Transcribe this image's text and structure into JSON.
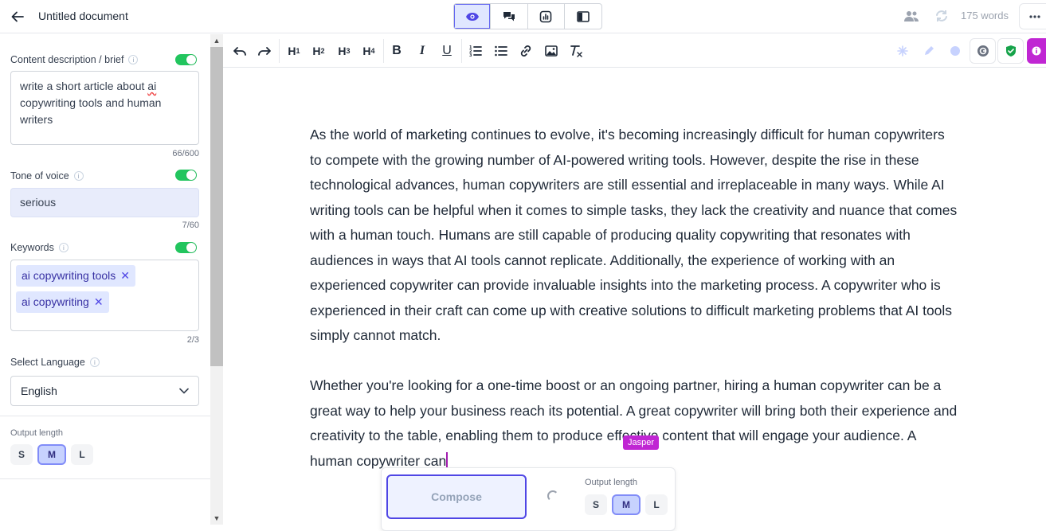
{
  "header": {
    "doc_title": "Untitled document",
    "word_count": "175 words",
    "view_modes": [
      "eye-icon",
      "chat-icon",
      "chart-icon",
      "sidebar-icon"
    ]
  },
  "left_panel": {
    "content_brief": {
      "label": "Content description / brief",
      "value_prefix": "write a short article about ",
      "value_misspelled": "ai",
      "value_suffix": " copywriting tools and human writers",
      "counter": "66/600",
      "enabled": true
    },
    "tone": {
      "label": "Tone of voice",
      "value": "serious",
      "counter": "7/60",
      "enabled": true
    },
    "keywords": {
      "label": "Keywords",
      "items": [
        "ai copywriting tools",
        "ai copywriting"
      ],
      "counter": "2/3",
      "enabled": true
    },
    "language": {
      "label": "Select Language",
      "value": "English"
    },
    "output_length": {
      "label": "Output length",
      "options": [
        "S",
        "M",
        "L"
      ],
      "selected": "M"
    }
  },
  "toolbar": {
    "headings": [
      {
        "h": "H",
        "n": "1"
      },
      {
        "h": "H",
        "n": "2"
      },
      {
        "h": "H",
        "n": "3"
      },
      {
        "h": "H",
        "n": "4"
      }
    ],
    "format": [
      "B",
      "I",
      "U"
    ]
  },
  "document": {
    "paragraph_1": "As the world of marketing continues to evolve, it's becoming increasingly difficult for human copywriters to compete with the growing number of AI-powered writing tools. However, despite the rise in these technological advances, human copywriters are still essential and irreplaceable in many ways. While AI writing tools can be helpful when it comes to simple tasks, they lack the creativity and nuance that comes with a human touch. Humans are still capable of producing quality copywriting that resonates with audiences in ways that AI tools cannot replicate. Additionally, the experience of working with an experienced copywriter can provide invaluable insights into the marketing process. A copywriter who is experienced in their craft can come up with creative solutions to difficult marketing problems that AI tools simply cannot match.",
    "paragraph_2": "Whether you're looking for a one-time boost or an ongoing partner, hiring a human copywriter can be a great way to help your business reach its potential. A great copywriter will bring both their experience and creativity to the table, enabling them to produce effective content that will engage your audience. A human copywriter can",
    "cursor_tag": "Jasper"
  },
  "compose": {
    "button_label": "Compose",
    "output_label": "Output length",
    "options": [
      "S",
      "M",
      "L"
    ],
    "selected": "M"
  },
  "colors": {
    "accent": "#4f46e5",
    "toggle_on": "#22c55e",
    "jasper": "#c026d3",
    "chip_bg": "#e0e7ff"
  }
}
